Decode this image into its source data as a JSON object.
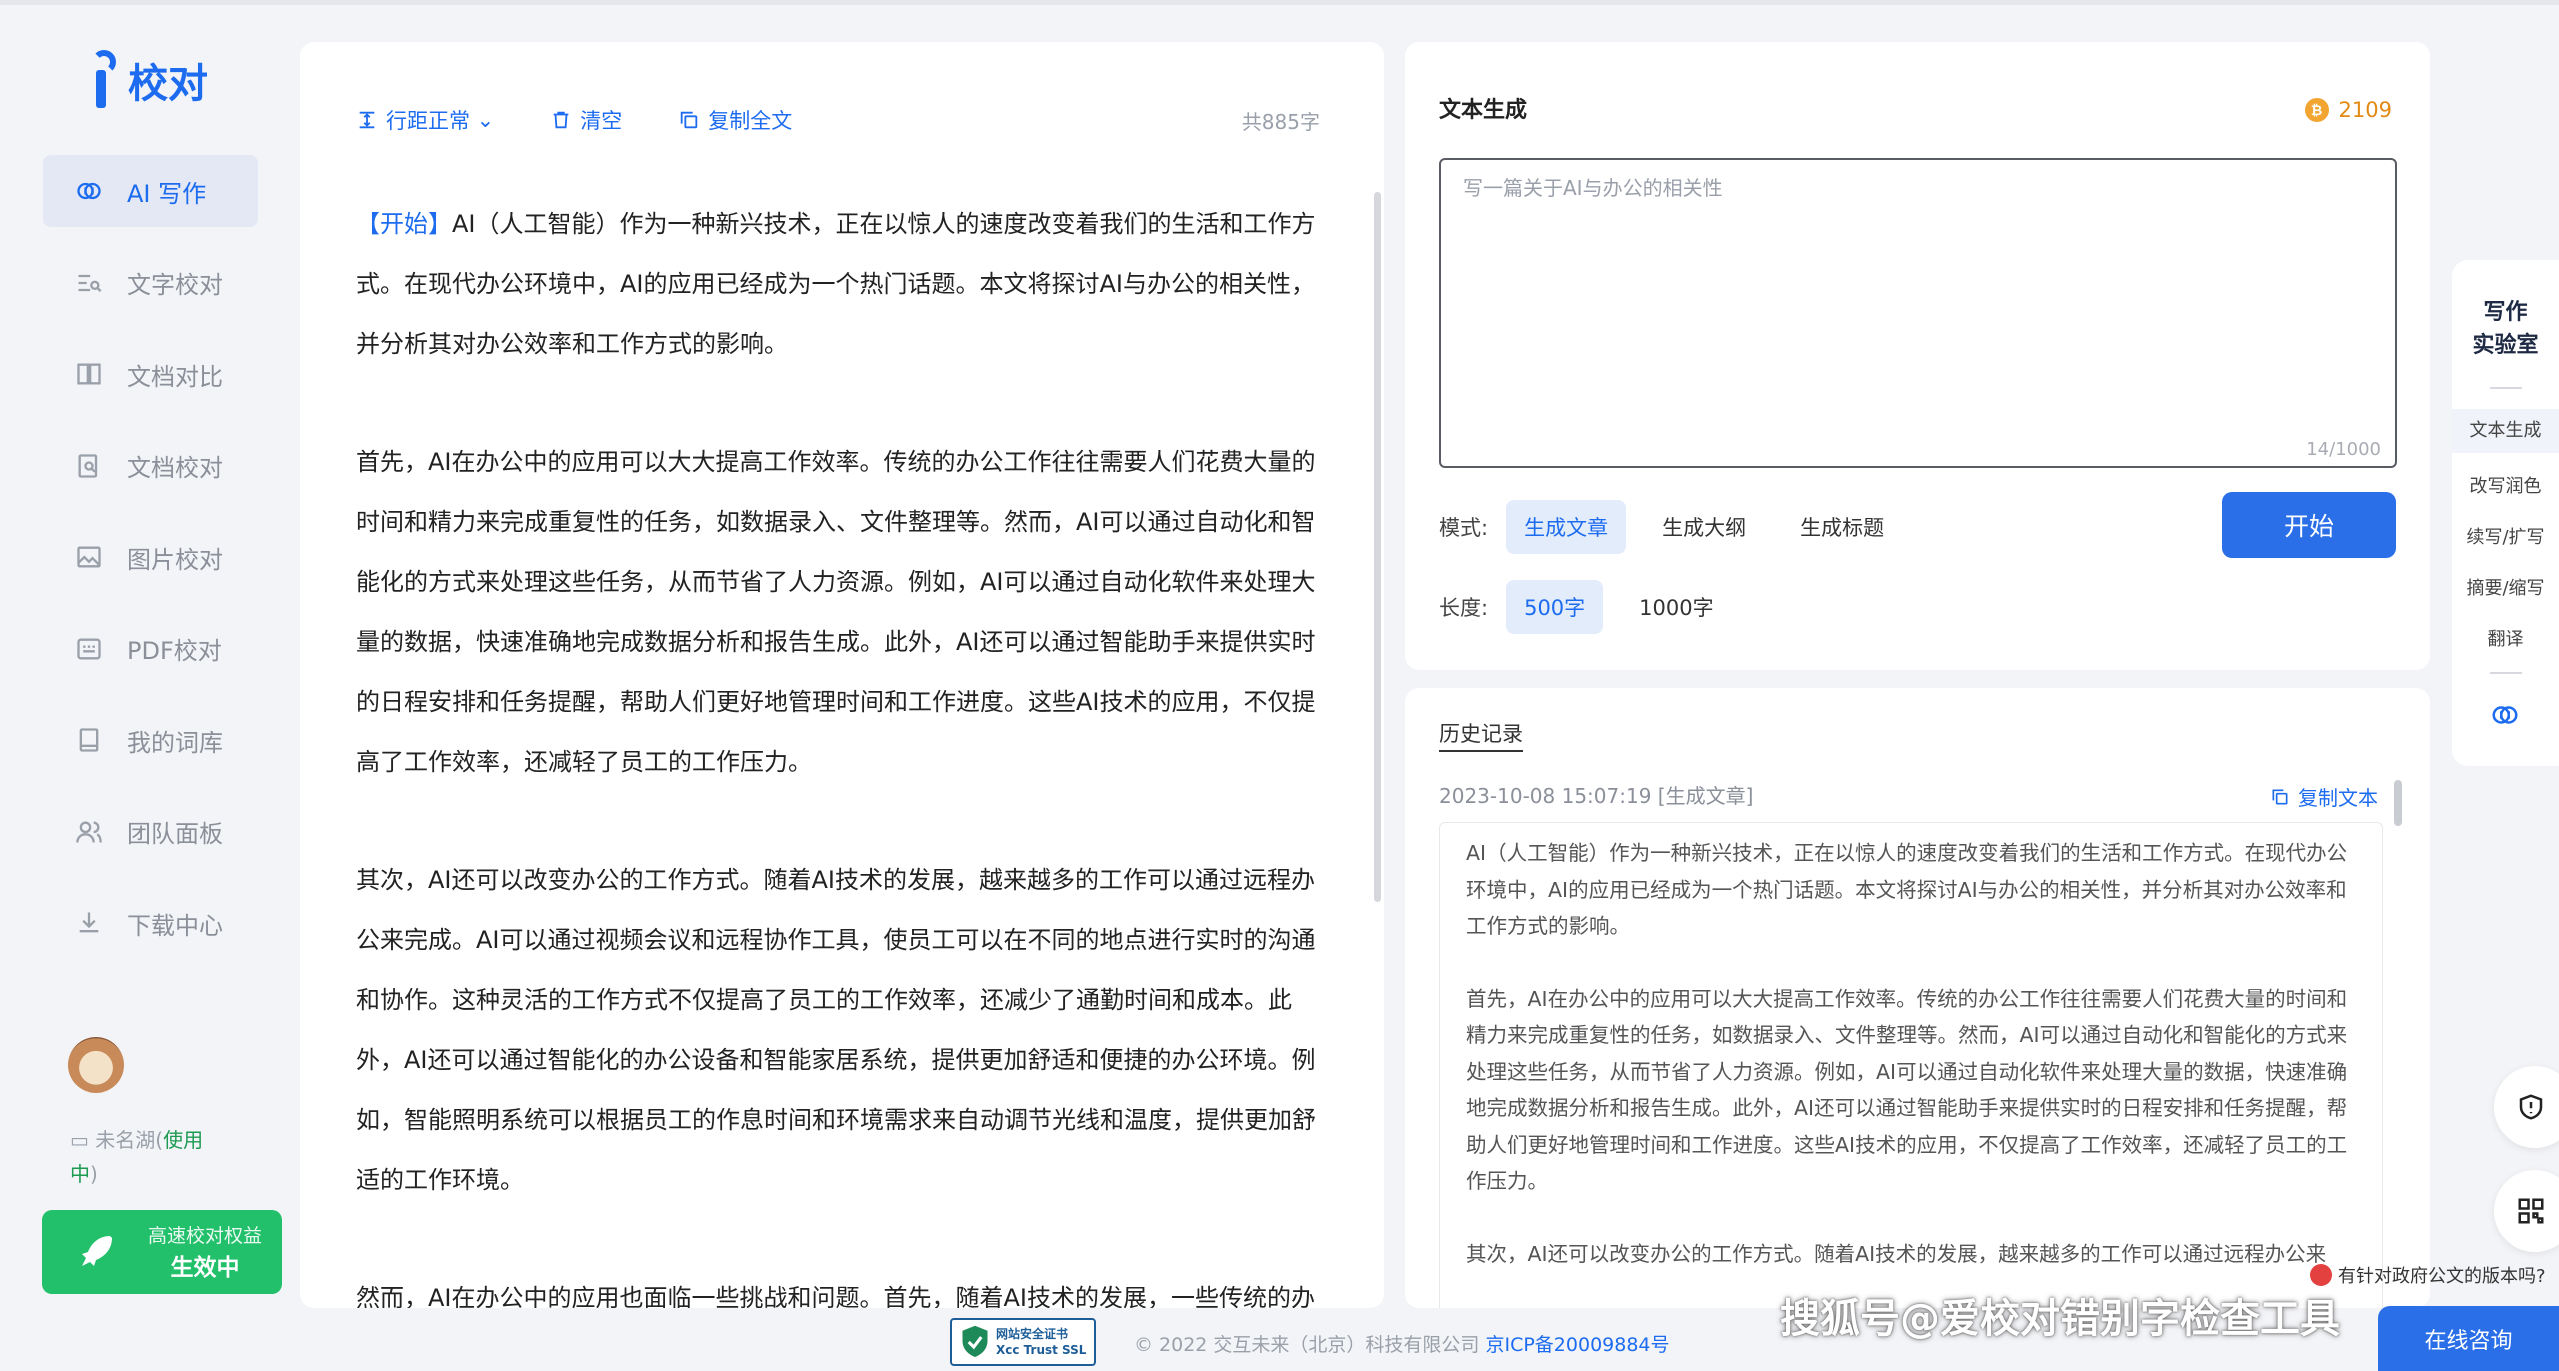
{
  "brand": {
    "logo_text": "校对"
  },
  "nav": {
    "items": [
      {
        "label": "AI 写作",
        "icon": "brain-icon",
        "active": true
      },
      {
        "label": "文字校对",
        "icon": "text-search-icon"
      },
      {
        "label": "文档对比",
        "icon": "compare-icon"
      },
      {
        "label": "文档校对",
        "icon": "document-search-icon"
      },
      {
        "label": "图片校对",
        "icon": "image-icon"
      },
      {
        "label": "PDF校对",
        "icon": "pdf-icon"
      },
      {
        "label": "我的词库",
        "icon": "book-icon"
      },
      {
        "label": "团队面板",
        "icon": "team-icon"
      },
      {
        "label": "下载中心",
        "icon": "download-icon"
      }
    ]
  },
  "user": {
    "name_prefix": "未名湖(",
    "name_link": "使用中",
    "name_suffix": ")"
  },
  "promo": {
    "line1": "高速校对权益",
    "line2": "生效中"
  },
  "editor": {
    "toolbar": {
      "line_spacing": "行距正常",
      "clear": "清空",
      "copy_all": "复制全文",
      "word_count": "共885字"
    },
    "start_tag": "【开始】",
    "paragraphs": [
      "AI（人工智能）作为一种新兴技术，正在以惊人的速度改变着我们的生活和工作方式。在现代办公环境中，AI的应用已经成为一个热门话题。本文将探讨AI与办公的相关性，并分析其对办公效率和工作方式的影响。",
      "首先，AI在办公中的应用可以大大提高工作效率。传统的办公工作往往需要人们花费大量的时间和精力来完成重复性的任务，如数据录入、文件整理等。然而，AI可以通过自动化和智能化的方式来处理这些任务，从而节省了人力资源。例如，AI可以通过自动化软件来处理大量的数据，快速准确地完成数据分析和报告生成。此外，AI还可以通过智能助手来提供实时的日程安排和任务提醒，帮助人们更好地管理时间和工作进度。这些AI技术的应用，不仅提高了工作效率，还减轻了员工的工作压力。",
      "其次，AI还可以改变办公的工作方式。随着AI技术的发展，越来越多的工作可以通过远程办公来完成。AI可以通过视频会议和远程协作工具，使员工可以在不同的地点进行实时的沟通和协作。这种灵活的工作方式不仅提高了员工的工作效率，还减少了通勤时间和成本。此外，AI还可以通过智能化的办公设备和智能家居系统，提供更加舒适和便捷的办公环境。例如，智能照明系统可以根据员工的作息时间和环境需求来自动调节光线和温度，提供更加舒适的工作环境。",
      "然而，AI在办公中的应用也面临一些挑战和问题。首先，随着AI技术的发展，一些传统的办"
    ]
  },
  "generator": {
    "title": "文本生成",
    "coins": "2109",
    "prompt_placeholder": "写一篇关于AI与办公的相关性",
    "prompt_count": "14/1000",
    "mode_label": "模式:",
    "modes": [
      "生成文章",
      "生成大纲",
      "生成标题"
    ],
    "length_label": "长度:",
    "lengths": [
      "500字",
      "1000字"
    ],
    "start_button": "开始"
  },
  "history": {
    "title": "历史记录",
    "date": "2023-10-08 15:07:19 [生成文章]",
    "copy": "复制文本",
    "paragraphs": [
      "AI（人工智能）作为一种新兴技术，正在以惊人的速度改变着我们的生活和工作方式。在现代办公环境中，AI的应用已经成为一个热门话题。本文将探讨AI与办公的相关性，并分析其对办公效率和工作方式的影响。",
      "首先，AI在办公中的应用可以大大提高工作效率。传统的办公工作往往需要人们花费大量的时间和精力来完成重复性的任务，如数据录入、文件整理等。然而，AI可以通过自动化和智能化的方式来处理这些任务，从而节省了人力资源。例如，AI可以通过自动化软件来处理大量的数据，快速准确地完成数据分析和报告生成。此外，AI还可以通过智能助手来提供实时的日程安排和任务提醒，帮助人们更好地管理时间和工作进度。这些AI技术的应用，不仅提高了工作效率，还减轻了员工的工作压力。",
      "其次，AI还可以改变办公的工作方式。随着AI技术的发展，越来越多的工作可以通过远程办公来"
    ]
  },
  "rail": {
    "title_line1": "写作",
    "title_line2": "实验室",
    "items": [
      "文本生成",
      "改写润色",
      "续写/扩写",
      "摘要/缩写",
      "翻译"
    ]
  },
  "footer": {
    "ssl_line1": "网站安全证书",
    "ssl_line2": "Xcc Trust SSL",
    "copyright": "© 2022 交互未来（北京）科技有限公司 ",
    "icp": "京ICP备20009884号"
  },
  "watermark": "搜狐号@爱校对错别字检查工具",
  "notice": "有针对政府公文的版本吗?",
  "consult": "在线咨询",
  "colors": {
    "accent": "#1d6cf0",
    "promo": "#22c06b",
    "button": "#2a6fe8",
    "coin": "#f2a530"
  }
}
